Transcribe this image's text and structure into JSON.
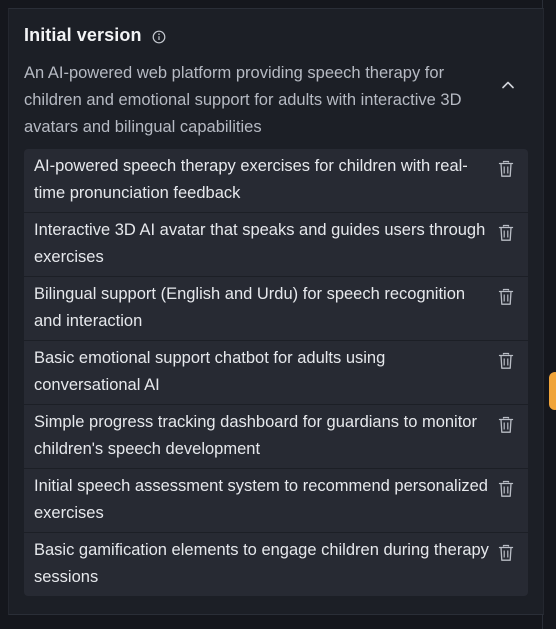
{
  "section": {
    "title": "Initial version",
    "description": "An AI-powered web platform providing speech therapy for children and emotional support for adults with interactive 3D avatars and bilingual capabilities"
  },
  "features": [
    {
      "text": "AI-powered speech therapy exercises for children with real-time pronunciation feedback"
    },
    {
      "text": "Interactive 3D AI avatar that speaks and guides users through exercises"
    },
    {
      "text": "Bilingual support (English and Urdu) for speech recognition and interaction"
    },
    {
      "text": "Basic emotional support chatbot for adults using conversational AI"
    },
    {
      "text": "Simple progress tracking dashboard for guardians to monitor children's speech development"
    },
    {
      "text": "Initial speech assessment system to recommend personalized exercises"
    },
    {
      "text": "Basic gamification elements to engage children during therapy sessions"
    }
  ],
  "icons": {
    "info": "info-icon",
    "collapse": "chevron-up-icon",
    "delete": "trash-icon"
  },
  "colors": {
    "background": "#15171d",
    "panel": "#1c1f26",
    "list_item": "#272a33",
    "accent_tab": "#f0a43a"
  }
}
